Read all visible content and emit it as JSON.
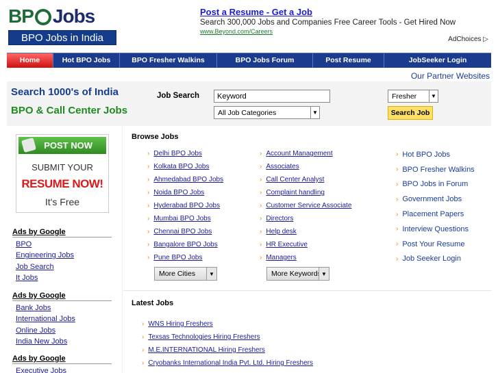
{
  "logo": {
    "bp": "BP",
    "jobs": "Jobs",
    "tagline": "BPO Jobs in India"
  },
  "ad": {
    "title": "Post a Resume - Get a Job",
    "desc": "Search 300,000 Jobs and Companies Free Career Tools - Get Hired Now",
    "url": "www.Beyond.com/Careers",
    "choices": "AdChoices ▷"
  },
  "nav": [
    "Home",
    "Hot BPO Jobs",
    "BPO Fresher Walkins",
    "BPO Jobs Forum",
    "Post Resume",
    "JobSeeker Login"
  ],
  "partner": "Our Partner Websites",
  "slogan": {
    "line1": "Search 1000's of India",
    "line2": "BPO & Call Center Jobs"
  },
  "search": {
    "label": "Job Search",
    "keyword_value": "Keyword",
    "category": "All Job Categories",
    "experience": "Fresher",
    "button": "Search Job"
  },
  "post_box": {
    "button": "POST NOW",
    "line1": "SUBMIT YOUR",
    "line2": "RESUME NOW!",
    "line3": "It's Free"
  },
  "ads_left": [
    {
      "heading": "Ads by Google",
      "links": [
        "BPO",
        "Engineering Jobs",
        "Job Search",
        "It Jobs"
      ]
    },
    {
      "heading": "Ads by Google",
      "links": [
        "Bank Jobs",
        "International Jobs",
        "Online Jobs",
        "India New Jobs"
      ]
    },
    {
      "heading": "Ads by Google",
      "links": [
        "Executive Jobs"
      ]
    }
  ],
  "browse": {
    "heading": "Browse Jobs",
    "cities": [
      "Delhi BPO Jobs",
      "Kolkata BPO Jobs",
      "Ahmedabad BPO Jobs",
      "Noida BPO Jobs",
      "Hyderabad BPO Jobs",
      "Mumbai BPO Jobs",
      "Chennai BPO Jobs",
      "Bangalore BPO Jobs",
      "Pune BPO Jobs"
    ],
    "categories": [
      "Account Management",
      "Associates",
      "Call Center Analyst",
      "Complaint handling",
      "Customer Service Associate",
      "Directors",
      "Help desk",
      "HR Executive",
      "Managers"
    ],
    "more_cities": "More Cities",
    "more_keywords": "More Keywords",
    "quick_links": [
      "Hot BPO Jobs",
      "BPO Fresher Walkins",
      "BPO Jobs in Forum",
      "Government Jobs",
      "Placement Papers",
      "Interview Questions",
      "Post Your Resume",
      "Job Seeker Login"
    ]
  },
  "latest": {
    "heading": "Latest Jobs",
    "items": [
      "WNS Hiring Freshers",
      "Texsas Technologies Hiring Freshers",
      "M.E.INTERNATIONAL Hiring Freshers",
      "Cryobanks International India Pvt. Ltd. Hiring Freshers"
    ]
  }
}
